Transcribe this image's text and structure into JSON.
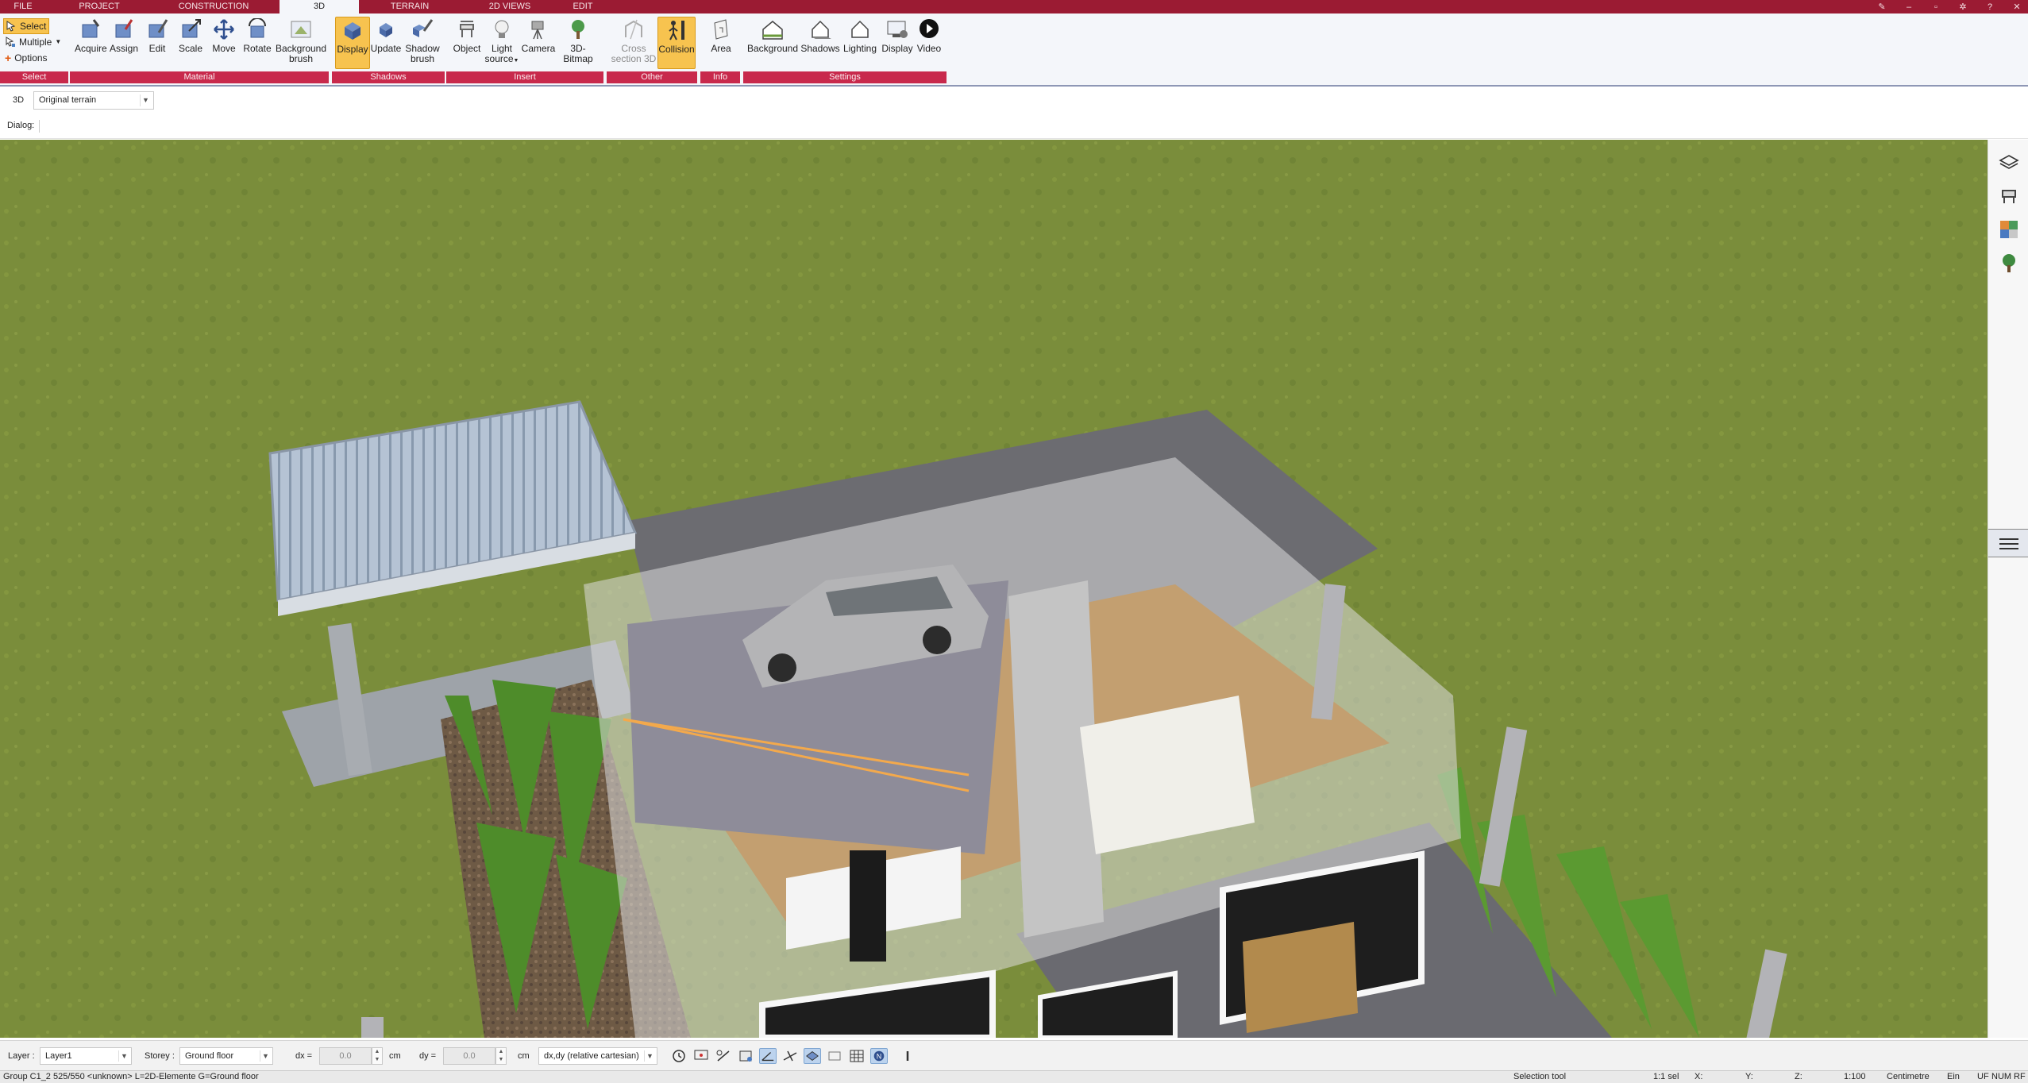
{
  "menu_tabs": [
    "FILE",
    "PROJECT",
    "CONSTRUCTION",
    "3D",
    "TERRAIN",
    "2D VIEWS",
    "EDIT"
  ],
  "active_tab": "3D",
  "ribbon": {
    "select_group": {
      "select_label": "Select",
      "multiple_label": "Multiple",
      "options_label": "Options",
      "group_label": "Select"
    },
    "material_group": {
      "acquire": "Acquire",
      "assign": "Assign",
      "edit": "Edit",
      "scale": "Scale",
      "move": "Move",
      "rotate": "Rotate",
      "background_brush_1": "Background",
      "background_brush_2": "brush",
      "group_label": "Material"
    },
    "shadows_group": {
      "display": "Display",
      "update": "Update",
      "shadow_brush_1": "Shadow",
      "shadow_brush_2": "brush",
      "group_label": "Shadows"
    },
    "insert_group": {
      "object": "Object",
      "light_source_1": "Light",
      "light_source_2": "source",
      "camera": "Camera",
      "bitmap": "3D-Bitmap",
      "group_label": "Insert"
    },
    "other_group": {
      "cross_section_1": "Cross",
      "cross_section_2": "section 3D",
      "collision": "Collision",
      "group_label": "Other"
    },
    "info_group": {
      "area": "Area",
      "group_label": "Info"
    },
    "settings_group": {
      "background": "Background",
      "shadows": "Shadows",
      "lighting": "Lighting",
      "display": "Display",
      "video": "Video",
      "group_label": "Settings"
    }
  },
  "view_bar": {
    "view_label": "3D",
    "terrain_value": "Original terrain"
  },
  "dialog_bar": {
    "label": "Dialog:"
  },
  "input_bar": {
    "layer_label": "Layer :",
    "layer_value": "Layer1",
    "storey_label": "Storey :",
    "storey_value": "Ground floor",
    "dx_label": "dx =",
    "dx_value": "0.0",
    "dx_unit": "cm",
    "dy_label": "dy =",
    "dy_value": "0.0",
    "dy_unit": "cm",
    "coord_mode": "dx,dy (relative cartesian)"
  },
  "status_bar": {
    "info": "Group C1_2 525/550 <unknown> L=2D-Elemente G=Ground floor",
    "tool": "Selection tool",
    "selection": "1:1 sel",
    "x_label": "X:",
    "y_label": "Y:",
    "z_label": "Z:",
    "scale": "1:100",
    "unit": "Centimetre",
    "ein": "Ein",
    "uf": "UF",
    "num": "NUM",
    "rf": "RF"
  },
  "icons": [
    "select-icon",
    "multiple-icon",
    "options-icon",
    "acquire-icon",
    "assign-icon",
    "edit-icon",
    "scale-icon",
    "move-icon",
    "rotate-icon",
    "background-brush-icon",
    "display-icon",
    "update-icon",
    "shadow-brush-icon",
    "object-icon",
    "light-source-icon",
    "camera-icon",
    "bitmap-icon",
    "cross-section-icon",
    "collision-icon",
    "area-icon",
    "background-icon",
    "shadows-icon",
    "lighting-icon",
    "settings-display-icon",
    "video-icon",
    "layers-icon",
    "furniture-icon",
    "materials-icon",
    "plant-icon"
  ],
  "colors": {
    "menubar": "#9b1b33",
    "group_bar": "#c8294c",
    "active_button": "#f7c34f",
    "grass": "#7b8e3c",
    "pavement": "#6f6f74"
  }
}
